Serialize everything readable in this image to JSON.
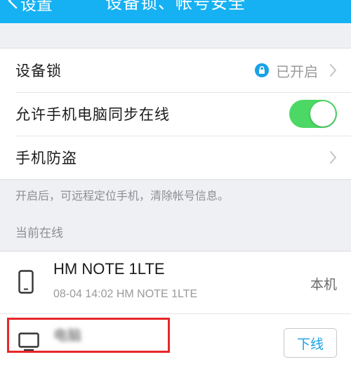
{
  "header": {
    "back_label": "设置",
    "title": "设备锁、帐号安全"
  },
  "settings": {
    "device_lock": {
      "label": "设备锁",
      "status": "已开启",
      "icon": "lock-icon"
    },
    "sync_online": {
      "label": "允许手机电脑同步在线",
      "enabled": true
    },
    "anti_theft": {
      "label": "手机防盗"
    }
  },
  "hint": "开启后，可远程定位手机，清除帐号信息。",
  "online": {
    "section_title": "当前在线",
    "devices": [
      {
        "name": "HM NOTE 1LTE",
        "time": "08-04 14:02 HM NOTE 1LTE",
        "tag": "本机",
        "icon": "phone-icon"
      },
      {
        "name": "电脑",
        "action": "下线",
        "icon": "computer-icon"
      }
    ]
  },
  "colors": {
    "header_bg": "#15b1f3",
    "toggle_on": "#4cd864",
    "lock_icon": "#1aa1e6",
    "action_text": "#1aa1e6",
    "highlight": "#e8262a"
  }
}
